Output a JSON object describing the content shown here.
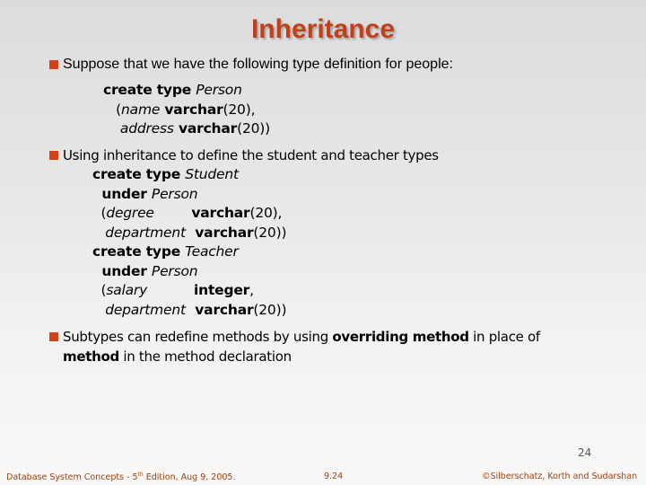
{
  "slide": {
    "title": "Inheritance",
    "accent_color": "#c0401a",
    "bullets": [
      {
        "text": "Suppose that we have the following type definition for people:",
        "code": [
          [
            {
              "t": "create type ",
              "s": "kw"
            },
            {
              "t": "Person",
              "s": "id"
            }
          ],
          [
            {
              "t": "   (",
              "s": ""
            },
            {
              "t": "name",
              "s": "id"
            },
            {
              "t": " varchar",
              "s": "kw"
            },
            {
              "t": "(20),",
              "s": ""
            }
          ],
          [
            {
              "t": "    ",
              "s": ""
            },
            {
              "t": "address",
              "s": "id"
            },
            {
              "t": " varchar",
              "s": "kw"
            },
            {
              "t": "(20))",
              "s": ""
            }
          ]
        ]
      },
      {
        "text": "Using inheritance to define the student and teacher types",
        "code": [
          [
            {
              "t": "create type ",
              "s": "kw"
            },
            {
              "t": "Student",
              "s": "id"
            }
          ],
          [
            {
              "t": "  under ",
              "s": "kw"
            },
            {
              "t": "Person",
              "s": "id"
            }
          ],
          [
            {
              "t": "  (",
              "s": ""
            },
            {
              "t": "degree",
              "s": "id"
            },
            {
              "t": "        varchar",
              "s": "kw"
            },
            {
              "t": "(20),",
              "s": ""
            }
          ],
          [
            {
              "t": "   ",
              "s": ""
            },
            {
              "t": "department",
              "s": "id"
            },
            {
              "t": "  varchar",
              "s": "kw"
            },
            {
              "t": "(20))",
              "s": ""
            }
          ],
          [
            {
              "t": "create type ",
              "s": "kw"
            },
            {
              "t": "Teacher",
              "s": "id"
            }
          ],
          [
            {
              "t": "  under ",
              "s": "kw"
            },
            {
              "t": "Person",
              "s": "id"
            }
          ],
          [
            {
              "t": "  (",
              "s": ""
            },
            {
              "t": "salary",
              "s": "id"
            },
            {
              "t": "          integer",
              "s": "kw"
            },
            {
              "t": ",",
              "s": ""
            }
          ],
          [
            {
              "t": "   ",
              "s": ""
            },
            {
              "t": "department",
              "s": "id"
            },
            {
              "t": "  varchar",
              "s": "kw"
            },
            {
              "t": "(20))",
              "s": ""
            }
          ]
        ]
      },
      {
        "parts": [
          {
            "t": "Subtypes can redefine methods by using ",
            "s": ""
          },
          {
            "t": "overriding method",
            "s": "kw"
          },
          {
            "t": " in place of",
            "s": ""
          }
        ],
        "parts2": [
          {
            "t": "method",
            "s": "kw"
          },
          {
            "t": " in the method declaration",
            "s": ""
          }
        ]
      }
    ],
    "page_number": "24",
    "footer": {
      "left_pre": "Database System Concepts - 5",
      "left_sup": "th",
      "left_post": " Edition, Aug 9, 2005.",
      "center": "9.24",
      "right": "©Silberschatz, Korth and Sudarshan"
    }
  }
}
